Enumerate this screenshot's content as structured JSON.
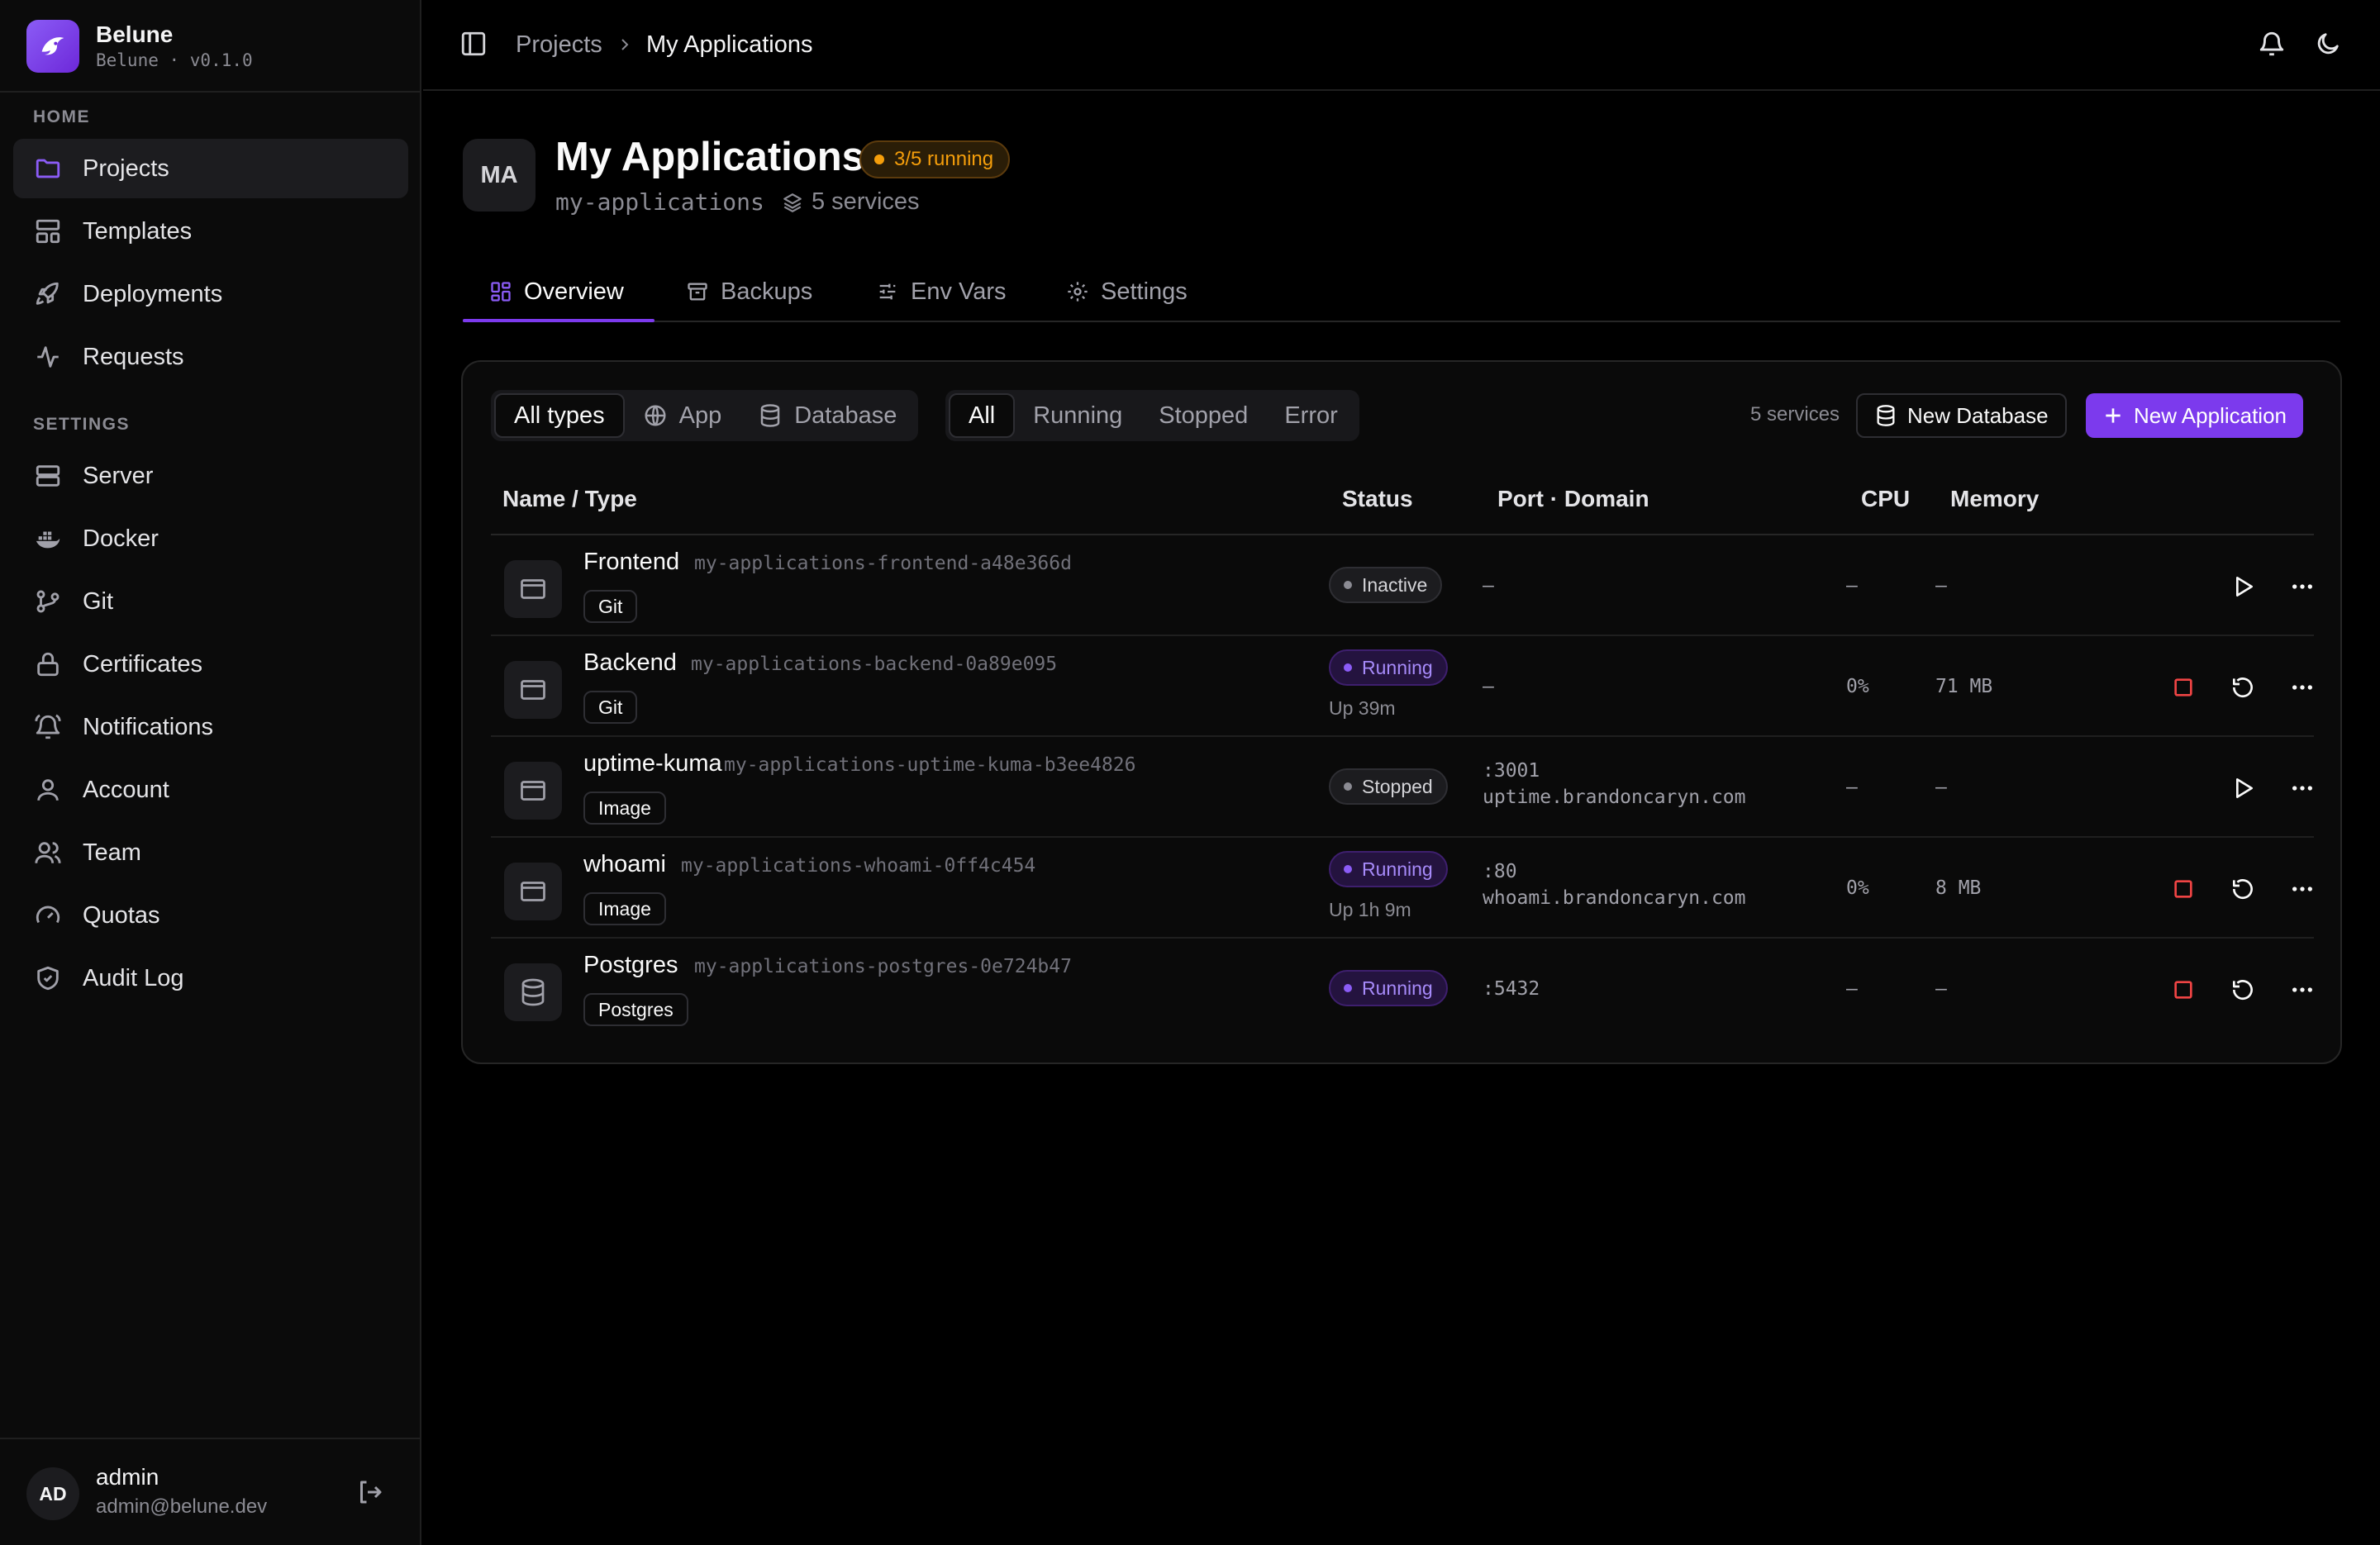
{
  "brand": {
    "name": "Belune",
    "subtitle": "Belune · v0.1.0"
  },
  "nav": {
    "home_label": "HOME",
    "settings_label": "SETTINGS",
    "home_items": [
      {
        "label": "Projects",
        "icon": "folder-icon"
      },
      {
        "label": "Templates",
        "icon": "layout-icon"
      },
      {
        "label": "Deployments",
        "icon": "rocket-icon"
      },
      {
        "label": "Requests",
        "icon": "activity-icon"
      }
    ],
    "settings_items": [
      {
        "label": "Server",
        "icon": "server-icon"
      },
      {
        "label": "Docker",
        "icon": "docker-icon"
      },
      {
        "label": "Git",
        "icon": "git-branch-icon"
      },
      {
        "label": "Certificates",
        "icon": "lock-icon"
      },
      {
        "label": "Notifications",
        "icon": "bell-ring-icon"
      },
      {
        "label": "Account",
        "icon": "user-icon"
      },
      {
        "label": "Team",
        "icon": "users-icon"
      },
      {
        "label": "Quotas",
        "icon": "gauge-icon"
      },
      {
        "label": "Audit Log",
        "icon": "shield-check-icon"
      }
    ]
  },
  "user": {
    "initials": "AD",
    "name": "admin",
    "email": "admin@belune.dev"
  },
  "breadcrumb": {
    "parent": "Projects",
    "current": "My Applications"
  },
  "project": {
    "initials": "MA",
    "title": "My Applications",
    "running_badge": "3/5 running",
    "slug": "my-applications",
    "services": "5 services"
  },
  "tabs": [
    "Overview",
    "Backups",
    "Env Vars",
    "Settings"
  ],
  "filters": {
    "types": [
      "All types",
      "App",
      "Database"
    ],
    "statuses": [
      "All",
      "Running",
      "Stopped",
      "Error"
    ],
    "count": "5 services",
    "new_database": "New Database",
    "new_application": "New Application"
  },
  "columns": [
    "Name / Type",
    "Status",
    "Port · Domain",
    "CPU",
    "Memory"
  ],
  "rows": [
    {
      "name": "Frontend",
      "slug": "my-applications-frontend-a48e366d",
      "tag": "Git",
      "status": "Inactive",
      "uptime": "",
      "port": "–",
      "domain": "",
      "cpu": "–",
      "mem": "–"
    },
    {
      "name": "Backend",
      "slug": "my-applications-backend-0a89e095",
      "tag": "Git",
      "status": "Running",
      "uptime": "Up 39m",
      "port": "–",
      "domain": "",
      "cpu": "0%",
      "mem": "71 MB"
    },
    {
      "name": "uptime-kuma",
      "slug": "my-applications-uptime-kuma-b3ee4826",
      "tag": "Image",
      "status": "Stopped",
      "uptime": "",
      "port": ":3001",
      "domain": "uptime.brandoncaryn.com",
      "cpu": "–",
      "mem": "–"
    },
    {
      "name": "whoami",
      "slug": "my-applications-whoami-0ff4c454",
      "tag": "Image",
      "status": "Running",
      "uptime": "Up 1h 9m",
      "port": ":80",
      "domain": "whoami.brandoncaryn.com",
      "cpu": "0%",
      "mem": "8 MB"
    },
    {
      "name": "Postgres",
      "slug": "my-applications-postgres-0e724b47",
      "tag": "Postgres",
      "status": "Running",
      "uptime": "",
      "port": ":5432",
      "domain": "",
      "cpu": "–",
      "mem": "–"
    }
  ],
  "colors": {
    "accent": "#7c3aed",
    "warning": "#f59e0b",
    "danger": "#ef4444"
  }
}
